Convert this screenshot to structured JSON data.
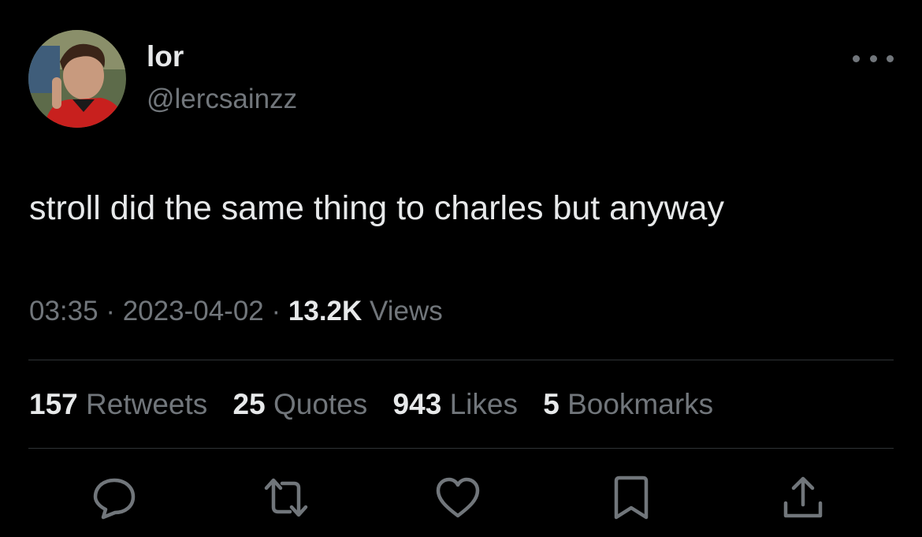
{
  "tweet": {
    "author": {
      "display_name": "lor",
      "handle": "@lercsainzz",
      "avatar_icon": "profile-photo"
    },
    "text": "stroll did the same thing to charles but anyway",
    "time": "03:35",
    "date": "2023-04-02",
    "separator": "·",
    "views_count": "13.2K",
    "views_label": "Views",
    "more_icon": "more-dots-icon"
  },
  "stats": {
    "retweets": {
      "count": "157",
      "label": "Retweets"
    },
    "quotes": {
      "count": "25",
      "label": "Quotes"
    },
    "likes": {
      "count": "943",
      "label": "Likes"
    },
    "bookmarks": {
      "count": "5",
      "label": "Bookmarks"
    }
  },
  "actions": [
    "reply-icon",
    "retweet-icon",
    "like-icon",
    "bookmark-icon",
    "share-icon"
  ],
  "colors": {
    "background": "#000000",
    "primary_text": "#e7e9ea",
    "secondary_text": "#71767b",
    "divider": "#2f3336"
  }
}
